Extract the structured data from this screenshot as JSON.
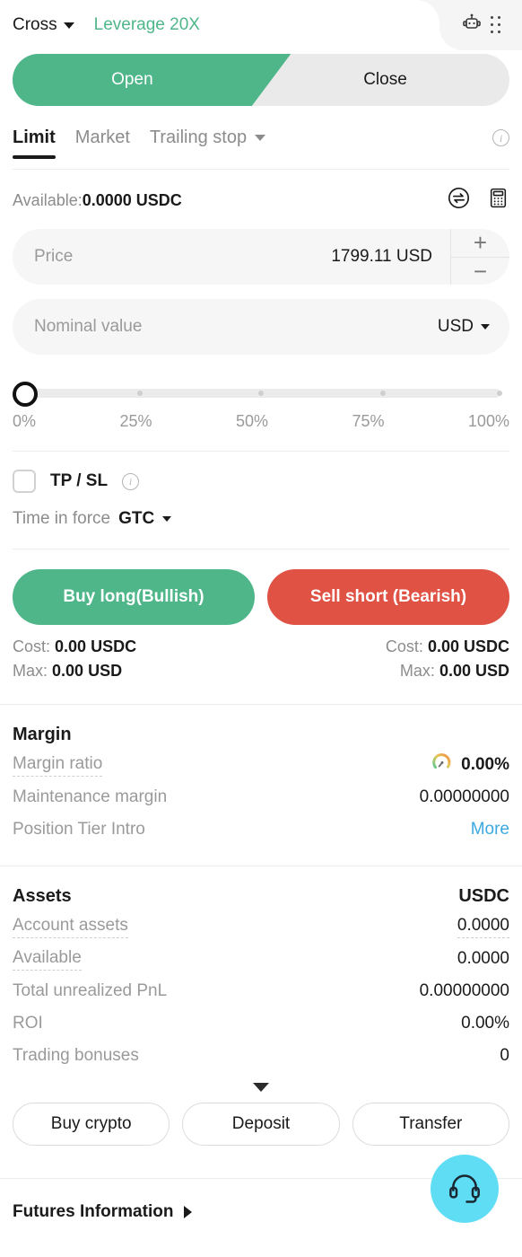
{
  "header": {
    "margin_mode": "Cross",
    "leverage": "Leverage 20X",
    "leverage_color": "#4FB68A",
    "bot_icon": "robot-icon",
    "grid_icon": "dots-grid-icon"
  },
  "position_tabs": {
    "open_label": "Open",
    "close_label": "Close",
    "active": "Open"
  },
  "order_type_tabs": {
    "items": [
      {
        "label": "Limit",
        "active": true
      },
      {
        "label": "Market",
        "active": false
      },
      {
        "label": "Trailing stop",
        "active": false,
        "has_caret": true
      }
    ],
    "info_icon": "info-icon"
  },
  "available": {
    "label": "Available:",
    "value": "0.0000 USDC",
    "swap_icon": "swap-icon",
    "calculator_icon": "calculator-icon"
  },
  "price_field": {
    "placeholder": "Price",
    "value": "1799.11 USD",
    "increment_label": "+",
    "decrement_label": "−"
  },
  "nominal_field": {
    "placeholder": "Nominal value",
    "unit": "USD"
  },
  "slider": {
    "value": 0,
    "ticks": [
      "0%",
      "25%",
      "50%",
      "75%",
      "100%"
    ]
  },
  "tpsl": {
    "label": "TP / SL",
    "checked": false,
    "info_icon": "info-icon"
  },
  "time_in_force": {
    "label": "Time in force",
    "value": "GTC"
  },
  "trade_actions": {
    "buy_label": "Buy long(Bullish)",
    "sell_label": "Sell short (Bearish)",
    "buy_color": "#4FB68A",
    "sell_color": "#DF5244",
    "buy_cost_label": "Cost:",
    "buy_cost_value": "0.00 USDC",
    "buy_max_label": "Max:",
    "buy_max_value": "0.00 USD",
    "sell_cost_label": "Cost:",
    "sell_cost_value": "0.00 USDC",
    "sell_max_label": "Max:",
    "sell_max_value": "0.00 USD"
  },
  "margin": {
    "title": "Margin",
    "rows": [
      {
        "label": "Margin ratio",
        "value": "0.00%",
        "gauge": true,
        "dashed": true
      },
      {
        "label": "Maintenance margin",
        "value": "0.00000000",
        "dashed": false
      },
      {
        "label": "Position Tier Intro",
        "value": "More",
        "link": true,
        "dashed": false
      }
    ]
  },
  "assets": {
    "title": "Assets",
    "currency": "USDC",
    "rows": [
      {
        "label": "Account assets",
        "value": "0.0000",
        "dashed": true,
        "value_dashed": true
      },
      {
        "label": "Available",
        "value": "0.0000",
        "dashed": true,
        "value_dashed": false
      },
      {
        "label": "Total unrealized PnL",
        "value": "0.00000000",
        "dashed": false
      },
      {
        "label": "ROI",
        "value": "0.00%",
        "dashed": false
      },
      {
        "label": "Trading bonuses",
        "value": "0",
        "dashed": false
      }
    ]
  },
  "wallet_actions": {
    "expand_icon": "chevron-down-icon",
    "buttons": [
      "Buy crypto",
      "Deposit",
      "Transfer"
    ]
  },
  "footer": {
    "title": "Futures Information",
    "arrow_icon": "chevron-right-icon"
  },
  "support": {
    "icon": "headset-icon",
    "color": "#5FDDF5"
  }
}
